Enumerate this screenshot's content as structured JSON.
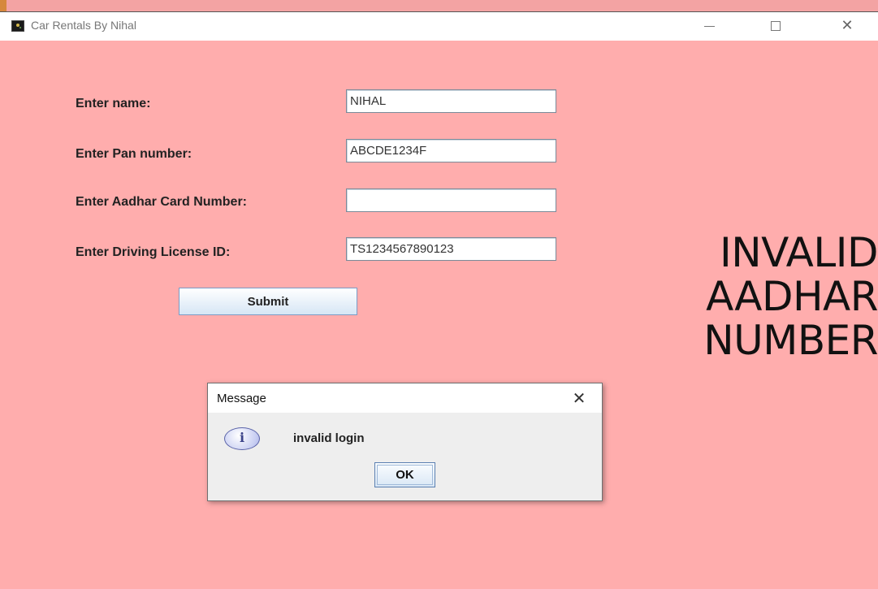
{
  "window": {
    "title": "Car Rentals By Nihal",
    "icons": {
      "app": "app-icon",
      "minimize": "minimize-icon",
      "maximize": "maximize-icon",
      "close": "close-icon"
    },
    "close_glyph": "✕"
  },
  "form": {
    "name_label": "Enter name:",
    "name_value": "NIHAL",
    "pan_label": "Enter Pan number:",
    "pan_value": "ABCDE1234F",
    "aadhar_label": "Enter Aadhar Card Number:",
    "aadhar_value": "",
    "license_label": "Enter Driving License ID:",
    "license_value": "TS1234567890123",
    "submit_label": "Submit"
  },
  "error_text": "INVALID\nAADHAR\nNUMBER",
  "dialog": {
    "title": "Message",
    "close_glyph": "✕",
    "icon": "info-icon",
    "icon_glyph": "i",
    "message": "invalid login",
    "ok_label": "OK"
  },
  "colors": {
    "background": "#ffadad",
    "titlebar": "#ffffff",
    "dialog_bg": "#eeeeee",
    "button_accent": "#7a9cc6"
  }
}
